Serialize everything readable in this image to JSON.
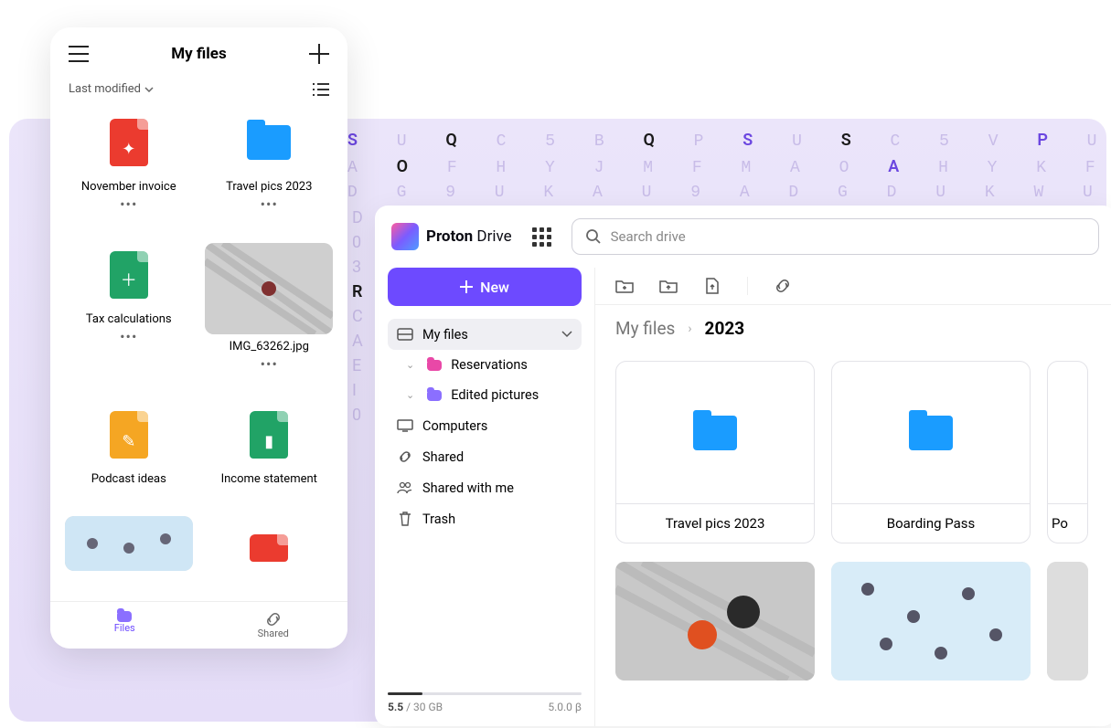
{
  "mobile": {
    "title": "My files",
    "sort_label": "Last modified",
    "files": [
      {
        "name": "November invoice"
      },
      {
        "name": "Travel pics 2023"
      },
      {
        "name": "Tax calculations"
      },
      {
        "name": "IMG_63262.jpg"
      },
      {
        "name": "Podcast ideas"
      },
      {
        "name": "Income statement"
      }
    ],
    "tabs": {
      "files": "Files",
      "shared": "Shared"
    }
  },
  "desktop": {
    "brand_bold": "Proton",
    "brand_light": "Drive",
    "search_placeholder": "Search drive",
    "new_label": "New",
    "sidebar": {
      "root": "My files",
      "items": [
        {
          "label": "Reservations"
        },
        {
          "label": "Edited pictures"
        }
      ],
      "computers": "Computers",
      "shared": "Shared",
      "shared_with_me": "Shared with me",
      "trash": "Trash"
    },
    "storage": {
      "used": "5.5",
      "total": "/ 30 GB",
      "version": "5.0.0 β"
    },
    "breadcrumb": {
      "root": "My files",
      "current": "2023"
    },
    "folders": [
      {
        "name": "Travel pics 2023"
      },
      {
        "name": "Boarding Pass"
      },
      {
        "name": "Po"
      }
    ]
  }
}
